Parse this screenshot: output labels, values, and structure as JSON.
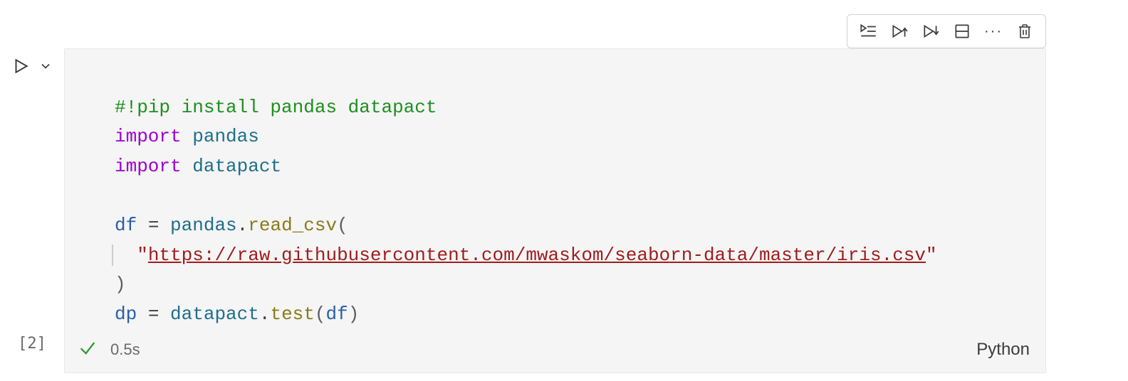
{
  "toolbar": {
    "run_by_line": "run-by-line",
    "run_above": "run-above",
    "run_below": "run-below",
    "split": "split-cell",
    "more": "···",
    "delete": "delete"
  },
  "gutter": {
    "execution_count": "[2]"
  },
  "code": {
    "line1_comment": "#!pip install pandas datapact",
    "line2_kw": "import",
    "line2_mod": "pandas",
    "line3_kw": "import",
    "line3_mod": "datapact",
    "line5_var": "df",
    "line5_op": " = ",
    "line5_mod": "pandas",
    "line5_dot": ".",
    "line5_method": "read_csv",
    "line5_paren_open": "(",
    "line6_str_open": "\"",
    "line6_url": "https://raw.githubusercontent.com/mwaskom/seaborn-data/master/iris.csv",
    "line6_str_close": "\"",
    "line7_paren_close": ")",
    "line8_var": "dp",
    "line8_op": " = ",
    "line8_mod": "datapact",
    "line8_dot": ".",
    "line8_method": "test",
    "line8_paren_open": "(",
    "line8_arg": "df",
    "line8_paren_close": ")"
  },
  "status": {
    "time": "0.5s",
    "language": "Python"
  }
}
